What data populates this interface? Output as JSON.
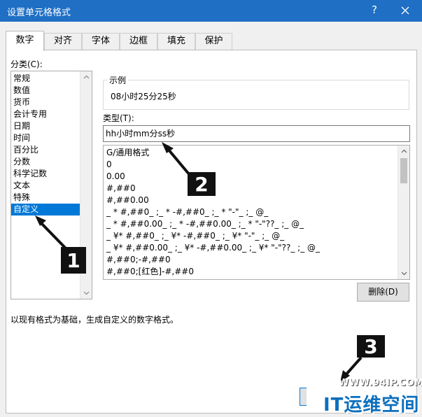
{
  "window": {
    "title": "设置单元格格式",
    "help_label": "?"
  },
  "tabs": [
    {
      "label": "数字",
      "active": true
    },
    {
      "label": "对齐",
      "active": false
    },
    {
      "label": "字体",
      "active": false
    },
    {
      "label": "边框",
      "active": false
    },
    {
      "label": "填充",
      "active": false
    },
    {
      "label": "保护",
      "active": false
    }
  ],
  "category": {
    "label": "分类(C):",
    "items": [
      "常规",
      "数值",
      "货币",
      "会计专用",
      "日期",
      "时间",
      "百分比",
      "分数",
      "科学记数",
      "文本",
      "特殊",
      "自定义"
    ],
    "selected": "自定义"
  },
  "sample": {
    "label": "示例",
    "value": "08小时25分25秒"
  },
  "type": {
    "label": "类型(T):",
    "value": "hh小时mm分ss秒"
  },
  "format_list": [
    "G/通用格式",
    "0",
    "0.00",
    "#,##0",
    "#,##0.00",
    "_ * #,##0_ ;_ * -#,##0_ ;_ * \"-\"_ ;_ @_",
    "_ * #,##0.00_ ;_ * -#,##0.00_ ;_ * \"-\"??_ ;_ @_",
    "_ ¥* #,##0_ ;_ ¥* -#,##0_ ;_ ¥* \"-\"_ ;_ @_",
    "_ ¥* #,##0.00_ ;_ ¥* -#,##0.00_ ;_ ¥* \"-\"??_ ;_ @_",
    "#,##0;-#,##0",
    "#,##0;[红色]-#,##0"
  ],
  "buttons": {
    "delete_label": "删除(D)"
  },
  "description": "以现有格式为基础，生成自定义的数字格式。",
  "annotations": {
    "callout_1": "1",
    "callout_2": "2",
    "callout_3": "3"
  },
  "watermark": {
    "url": "WWW.94IP.COM",
    "brand": "IT运维空间"
  },
  "colors": {
    "titlebar": "#1f6fc5",
    "selection": "#0078d7",
    "callout": "#111111"
  }
}
